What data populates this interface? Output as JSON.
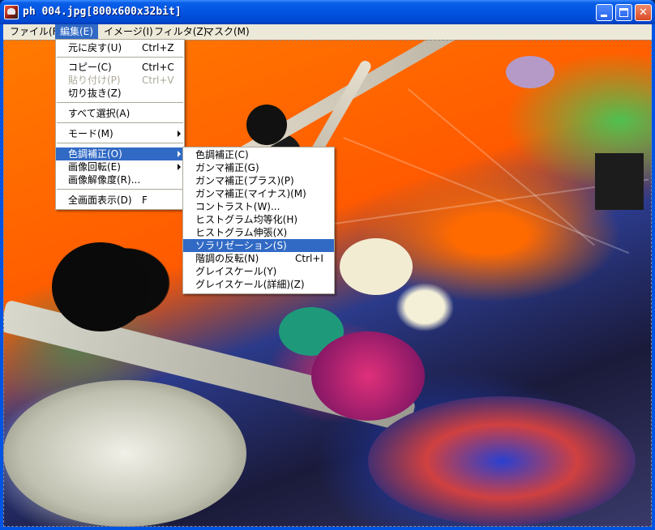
{
  "window": {
    "title": "ph 004.jpg[800x600x32bit]"
  },
  "menubar": [
    {
      "label": "ファイル(F)"
    },
    {
      "label": "編集(E)"
    },
    {
      "label": "イメージ(I)"
    },
    {
      "label": "フィルタ(Z)"
    },
    {
      "label": "マスク(M)"
    }
  ],
  "edit_menu": {
    "items": [
      {
        "label": "元に戻す(U)",
        "shortcut": "Ctrl+Z",
        "enabled": true
      },
      {
        "label": "コピー(C)",
        "shortcut": "Ctrl+C",
        "enabled": true
      },
      {
        "label": "貼り付け(P)",
        "shortcut": "Ctrl+V",
        "enabled": false
      },
      {
        "label": "切り抜き(Z)",
        "shortcut": "",
        "enabled": true
      },
      {
        "label": "すべて選択(A)",
        "shortcut": "",
        "enabled": true
      },
      {
        "label": "モード(M)",
        "shortcut": "",
        "enabled": true
      },
      {
        "label": "色調補正(O)",
        "shortcut": "",
        "enabled": true
      },
      {
        "label": "画像回転(E)",
        "shortcut": "",
        "enabled": true
      },
      {
        "label": "画像解像度(R)...",
        "shortcut": "",
        "enabled": true
      },
      {
        "label": "全画面表示(D)",
        "shortcut": "F",
        "enabled": true
      }
    ]
  },
  "color_submenu": {
    "items": [
      {
        "label": "色調補正(C)",
        "shortcut": ""
      },
      {
        "label": "ガンマ補正(G)",
        "shortcut": ""
      },
      {
        "label": "ガンマ補正(プラス)(P)",
        "shortcut": ""
      },
      {
        "label": "ガンマ補正(マイナス)(M)",
        "shortcut": ""
      },
      {
        "label": "コントラスト(W)...",
        "shortcut": ""
      },
      {
        "label": "ヒストグラム均等化(H)",
        "shortcut": ""
      },
      {
        "label": "ヒストグラム伸張(X)",
        "shortcut": ""
      },
      {
        "label": "ソラリゼーション(S)",
        "shortcut": ""
      },
      {
        "label": "階調の反転(N)",
        "shortcut": "Ctrl+I"
      },
      {
        "label": "グレイスケール(Y)",
        "shortcut": ""
      },
      {
        "label": "グレイスケール(詳細)(Z)",
        "shortcut": ""
      }
    ]
  },
  "colors": {
    "highlight": "#316ac5",
    "menubar_bg": "#ece9d8",
    "titlebar": "#0054e3",
    "disabled_text": "#aca899"
  }
}
